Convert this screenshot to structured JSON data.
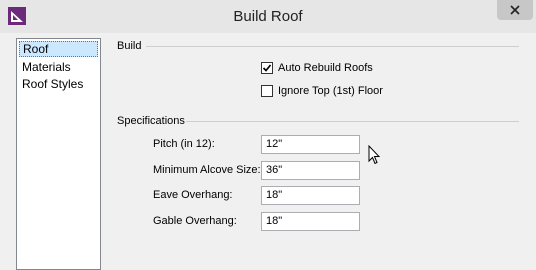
{
  "window": {
    "title": "Build Roof"
  },
  "sidebar": {
    "items": [
      {
        "label": "Roof",
        "selected": true
      },
      {
        "label": "Materials",
        "selected": false
      },
      {
        "label": "Roof Styles",
        "selected": false
      }
    ]
  },
  "build": {
    "heading": "Build",
    "auto_rebuild": {
      "label": "Auto Rebuild Roofs",
      "checked": true
    },
    "ignore_top": {
      "label": "Ignore Top (1st) Floor",
      "checked": false
    }
  },
  "specs": {
    "heading": "Specifications",
    "fields": [
      {
        "label": "Pitch (in 12):",
        "value": "12\""
      },
      {
        "label": "Minimum Alcove Size:",
        "value": "36\""
      },
      {
        "label": "Eave Overhang:",
        "value": "18\""
      },
      {
        "label": "Gable Overhang:",
        "value": "18\""
      }
    ]
  },
  "colors": {
    "accent": "#6b2a7a",
    "selection": "#cce8ff"
  }
}
